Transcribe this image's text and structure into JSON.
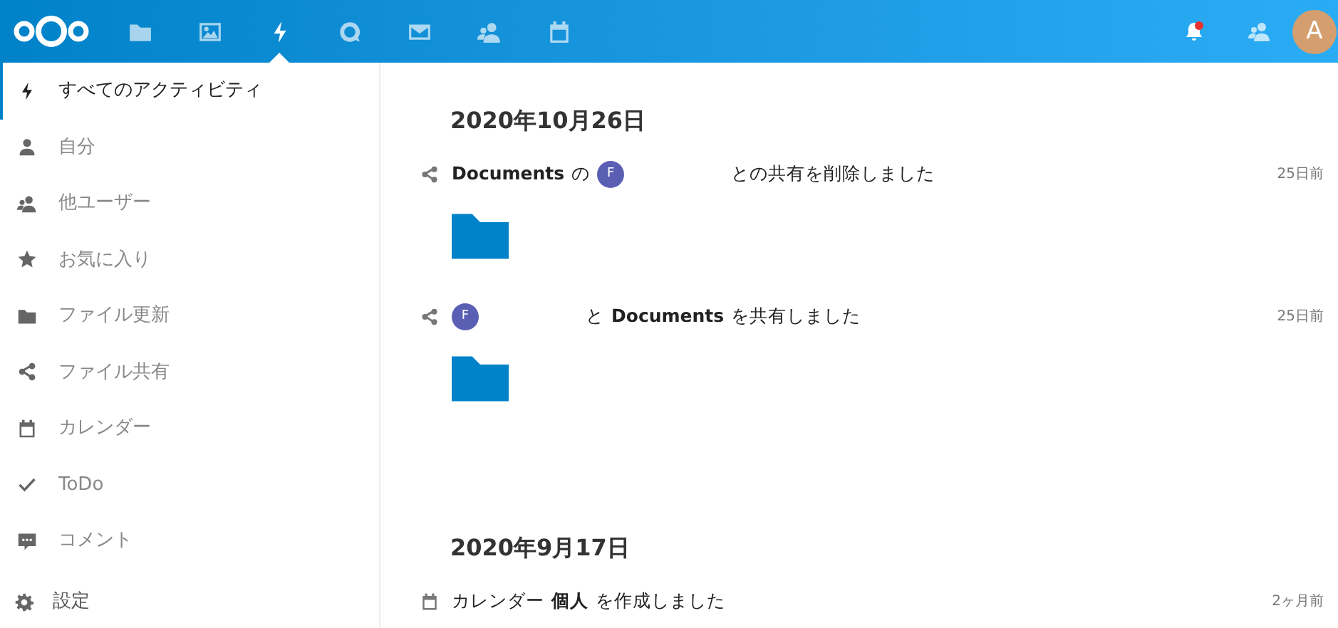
{
  "header": {
    "apps": [
      {
        "kind": "files",
        "selected": false
      },
      {
        "kind": "photos",
        "selected": false
      },
      {
        "kind": "activity",
        "selected": true
      },
      {
        "kind": "talk",
        "selected": false
      },
      {
        "kind": "mail",
        "selected": false
      },
      {
        "kind": "contacts",
        "selected": false
      },
      {
        "kind": "calendar",
        "selected": false
      }
    ],
    "avatar": {
      "letter": "A"
    }
  },
  "sidebar": {
    "items": [
      {
        "kind": "bolt",
        "label": "すべてのアクティビティ",
        "selected": true
      },
      {
        "kind": "user",
        "label": "自分",
        "selected": false
      },
      {
        "kind": "users",
        "label": "他ユーザー",
        "selected": false
      },
      {
        "kind": "star",
        "label": "お気に入り",
        "selected": false
      },
      {
        "kind": "folder",
        "label": "ファイル更新",
        "selected": false
      },
      {
        "kind": "share",
        "label": "ファイル共有",
        "selected": false
      },
      {
        "kind": "calendar",
        "label": "カレンダー",
        "selected": false
      },
      {
        "kind": "check",
        "label": "ToDo",
        "selected": false
      },
      {
        "kind": "comment",
        "label": "コメント",
        "selected": false
      }
    ],
    "settings": {
      "label": "設定"
    }
  },
  "days": [
    {
      "date": "2020年10月26日",
      "activities": [
        {
          "kind": "share",
          "time": "25日前",
          "subject": [
            {
              "kind": "bold",
              "text": "Documents"
            },
            {
              "kind": "text",
              "text": "の"
            },
            {
              "kind": "avatar",
              "text": "F"
            },
            {
              "kind": "text",
              "text": "との共有を削除しました"
            }
          ],
          "previews": [
            {
              "kind": "folder"
            }
          ]
        },
        {
          "kind": "share",
          "time": "25日前",
          "subject": [
            {
              "kind": "avatar",
              "text": "F"
            },
            {
              "kind": "text",
              "text": "と"
            },
            {
              "kind": "bold",
              "text": "Documents"
            },
            {
              "kind": "text",
              "text": "を共有しました"
            }
          ],
          "previews": [
            {
              "kind": "folder"
            }
          ]
        }
      ]
    },
    {
      "date": "2020年9月17日",
      "activities": [
        {
          "kind": "calendar",
          "time": "2ヶ月前",
          "subject": [
            {
              "kind": "text",
              "text": "カレンダー"
            },
            {
              "kind": "bold",
              "text": "個人"
            },
            {
              "kind": "text",
              "text": "を作成しました"
            }
          ]
        }
      ]
    }
  ]
}
